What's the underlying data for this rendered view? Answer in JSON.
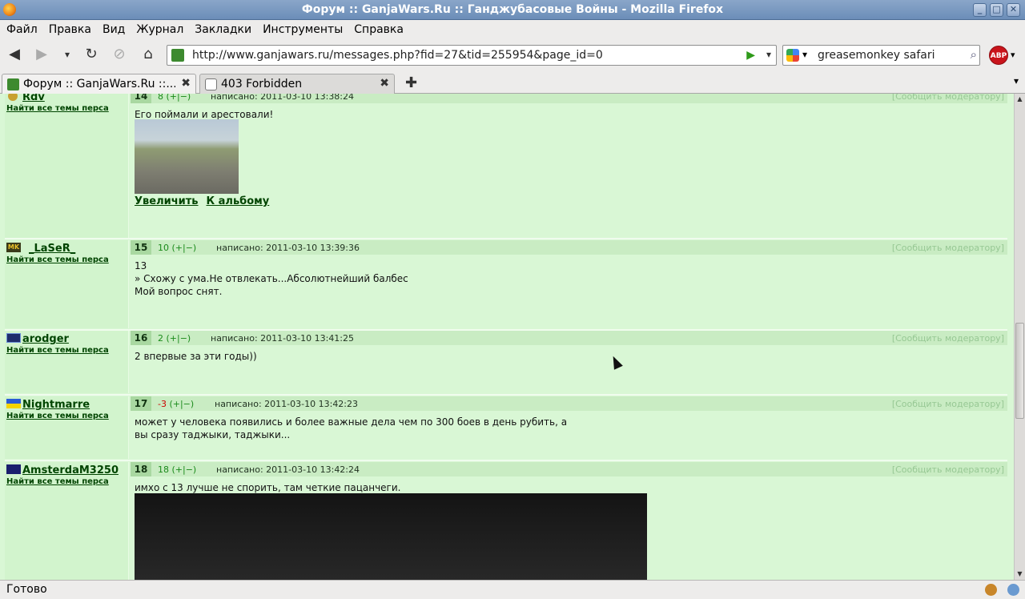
{
  "window": {
    "title": "Форум :: GanjaWars.Ru :: Ганджубасовые Войны - Mozilla Firefox"
  },
  "menu": [
    "Файл",
    "Правка",
    "Вид",
    "Журнал",
    "Закладки",
    "Инструменты",
    "Справка"
  ],
  "nav": {
    "url": "http://www.ganjawars.ru/messages.php?fid=27&tid=255954&page_id=0",
    "search_value": "greasemonkey safari",
    "abp_label": "ABP"
  },
  "tabs": [
    {
      "label": "Форум :: GanjaWars.Ru ::...",
      "active": true
    },
    {
      "label": "403 Forbidden",
      "active": false
    }
  ],
  "find_all_label": "Найти все темы перса",
  "report_label": "[Сообщить модератору]",
  "posts": [
    {
      "num": "14",
      "author": "Rdv",
      "rating_prefix": "8",
      "rating_suffix": " (+|−)",
      "date": "написано: 2011-03-10 13:38:24",
      "lines": [
        "Его поймали и арестовали!"
      ],
      "links": [
        "Увеличить",
        "К альбому"
      ]
    },
    {
      "num": "15",
      "author": "_LaSeR_",
      "rating_prefix": "10",
      "rating_suffix": " (+|−)",
      "date": "написано: 2011-03-10 13:39:36",
      "lines": [
        "13",
        "» Схожу с ума.Не отвлекать...Абсолютнейший балбес",
        "",
        "Мой вопрос снят."
      ]
    },
    {
      "num": "16",
      "author": "arodger",
      "rating_prefix": "2",
      "rating_suffix": " (+|−)",
      "date": "написано: 2011-03-10 13:41:25",
      "lines": [
        "2 впервые за эти годы))"
      ]
    },
    {
      "num": "17",
      "author": "Nightmarre",
      "rating_prefix": "-3",
      "rating_suffix": " (+|−)",
      "date": "написано: 2011-03-10 13:42:23",
      "lines": [
        "может у человека появились и более важные дела чем по 300 боев в день рубить, а",
        "вы сразу таджыки, таджыки..."
      ]
    },
    {
      "num": "18",
      "author": "AmsterdaM3250",
      "rating_prefix": "18",
      "rating_suffix": " (+|−)",
      "date": "написано: 2011-03-10 13:42:24",
      "lines": [
        "имхо с 13 лучше не спорить, там четкие пацанчеги."
      ]
    }
  ],
  "status": {
    "text": "Готово"
  },
  "colors": {
    "page_bg": "#d9f7d5",
    "author_bg": "#d2f4cd",
    "header_bg": "#c9ecc3",
    "link": "#004400",
    "negative": "#cc0000"
  }
}
